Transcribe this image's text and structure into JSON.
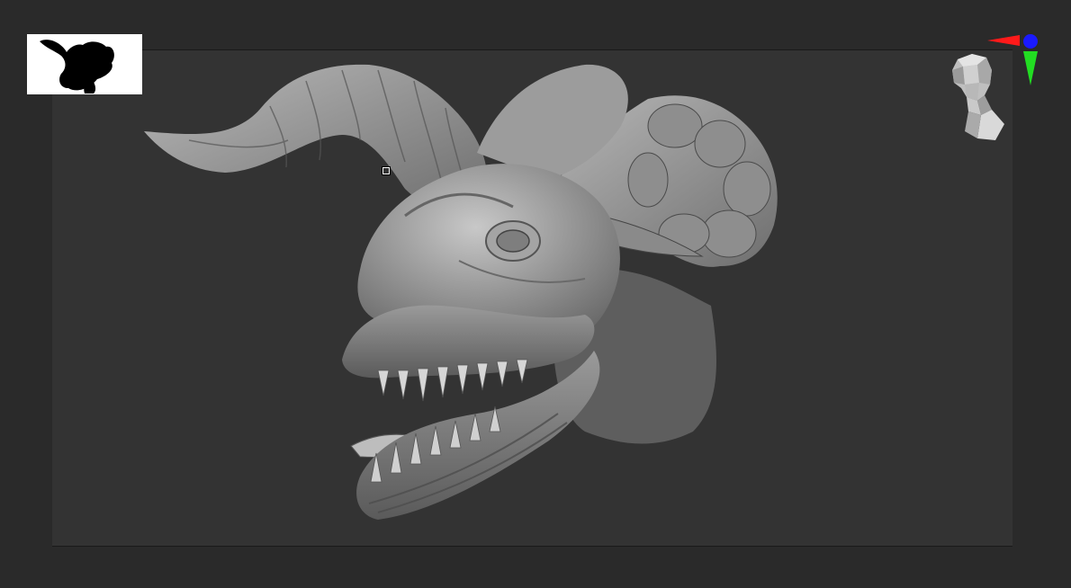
{
  "app": {
    "colors": {
      "background": "#2a2a2a",
      "canvas": "#333333",
      "navigator_bg": "#ffffff",
      "axis_x": "#ff1a1a",
      "axis_y": "#22dd22",
      "axis_z": "#1a1aff"
    }
  },
  "viewport": {
    "model": "dragon-head-sculpt-icon",
    "navigator": "silhouette-navigator-icon",
    "orientation_head": "head-orientation-icon",
    "gizmo": "axis-gizmo-icon"
  }
}
